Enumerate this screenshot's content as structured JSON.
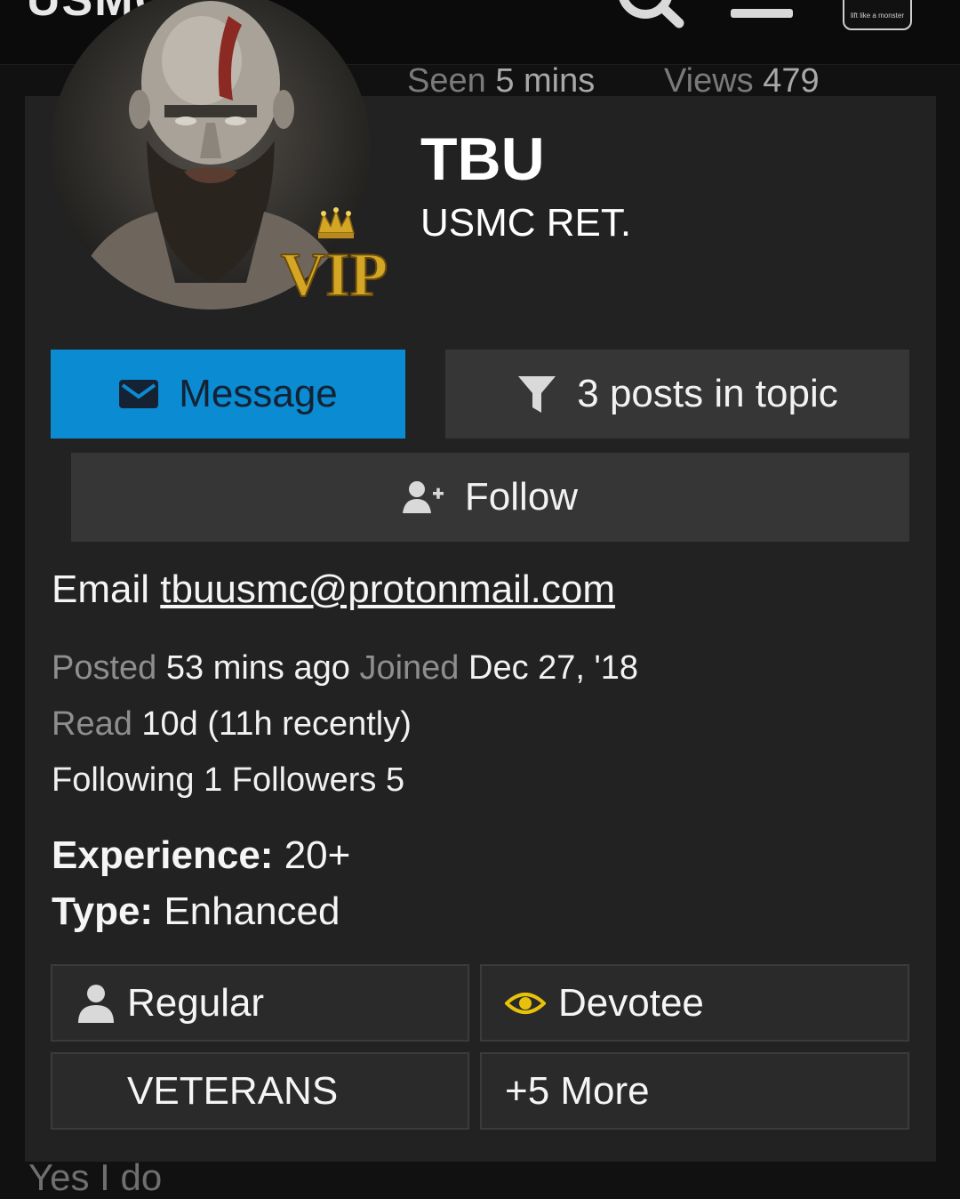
{
  "topbar": {
    "logo_text": "USMC",
    "thumb_text": "lift like a monster"
  },
  "stats": {
    "seen_label": "Seen",
    "seen_value": "5 mins",
    "views_label": "Views",
    "views_value": "479"
  },
  "profile": {
    "name": "TBU",
    "title": "USMC RET.",
    "vip_text": "VIP"
  },
  "buttons": {
    "message": "Message",
    "posts_in_topic": "3 posts in topic",
    "follow": "Follow"
  },
  "email": {
    "label": "Email",
    "address": "tbuusmc@protonmail.com"
  },
  "activity": {
    "posted_label": "Posted",
    "posted_value": "53 mins ago",
    "joined_label": "Joined",
    "joined_value": "Dec 27, '18",
    "read_label": "Read",
    "read_value": "10d (11h recently)",
    "following_label": "Following",
    "following_value": "1",
    "followers_label": "Followers",
    "followers_value": "5"
  },
  "fields": {
    "experience_label": "Experience:",
    "experience_value": "20+",
    "type_label": "Type:",
    "type_value": "Enhanced"
  },
  "tags": {
    "regular": "Regular",
    "devotee": "Devotee",
    "veterans": "VETERANS",
    "more": "+5 More"
  },
  "below": {
    "post_text": "Yes I do"
  },
  "colors": {
    "message_button": "#0a8bd2",
    "card_background": "#222222",
    "devotee_icon": "#e8c20a",
    "vip_gold": "#d4a626"
  }
}
